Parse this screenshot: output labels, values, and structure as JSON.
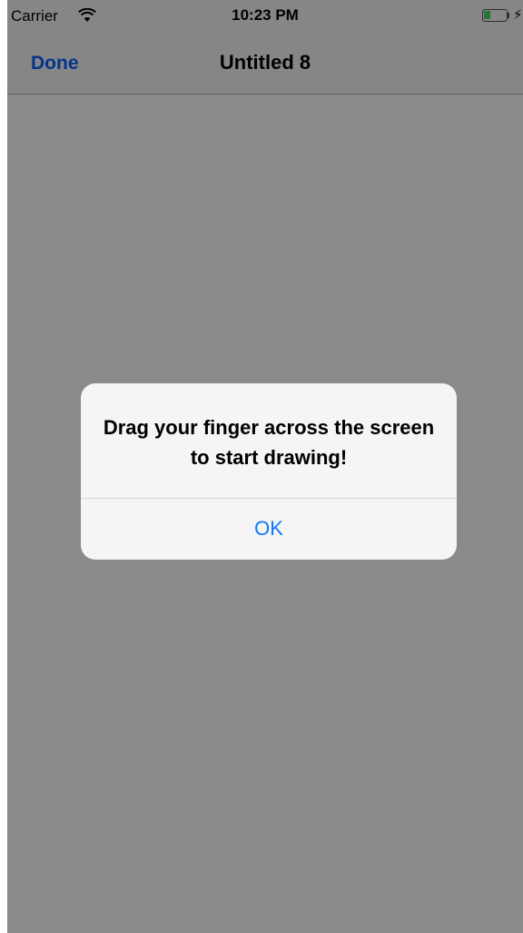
{
  "status_bar": {
    "carrier": "Carrier",
    "time": "10:23 PM",
    "wifi_icon": "wifi-icon",
    "battery_level": 0.3,
    "battery_color": "#4cd964",
    "charging_icon": "bolt-icon"
  },
  "nav_bar": {
    "done_label": "Done",
    "title": "Untitled 8",
    "accent_color": "#0a60fe"
  },
  "alert": {
    "message": "Drag your finger across the screen to start drawing!",
    "ok_label": "OK",
    "button_color": "#0a7afe"
  }
}
